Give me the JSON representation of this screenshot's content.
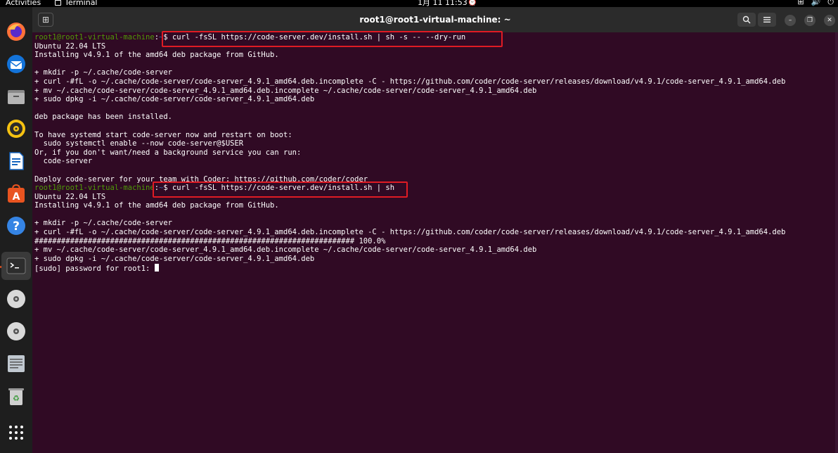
{
  "topbar": {
    "activities": "Activities",
    "app_name": "Terminal",
    "clock": "1月 11  11:53"
  },
  "window": {
    "title": "root1@root1-virtual-machine: ~"
  },
  "dock": {
    "items": [
      {
        "name": "firefox-icon"
      },
      {
        "name": "thunderbird-icon"
      },
      {
        "name": "files-icon"
      },
      {
        "name": "rhythmbox-icon"
      },
      {
        "name": "libreoffice-writer-icon"
      },
      {
        "name": "app-center-icon"
      },
      {
        "name": "help-icon"
      },
      {
        "name": "terminal-icon"
      },
      {
        "name": "disc-icon"
      },
      {
        "name": "disc-icon-2"
      },
      {
        "name": "text-editor-icon"
      },
      {
        "name": "trash-icon"
      },
      {
        "name": "show-apps-icon"
      }
    ]
  },
  "terminal": {
    "prompt_user": "root1@root1-virtual-machine",
    "prompt_sep": ":",
    "prompt_path": "~",
    "cmd1": "$ curl -fsSL https://code-server.dev/install.sh | sh -s -- --dry-run",
    "out1": [
      "Ubuntu 22.04 LTS",
      "Installing v4.9.1 of the amd64 deb package from GitHub.",
      "",
      "+ mkdir -p ~/.cache/code-server",
      "+ curl -#fL -o ~/.cache/code-server/code-server_4.9.1_amd64.deb.incomplete -C - https://github.com/coder/code-server/releases/download/v4.9.1/code-server_4.9.1_amd64.deb",
      "+ mv ~/.cache/code-server/code-server_4.9.1_amd64.deb.incomplete ~/.cache/code-server/code-server_4.9.1_amd64.deb",
      "+ sudo dpkg -i ~/.cache/code-server/code-server_4.9.1_amd64.deb",
      "",
      "deb package has been installed.",
      "",
      "To have systemd start code-server now and restart on boot:",
      "  sudo systemctl enable --now code-server@$USER",
      "Or, if you don't want/need a background service you can run:",
      "  code-server",
      "",
      "Deploy code-server for your team with Coder: https://github.com/coder/coder"
    ],
    "cmd2": "$ curl -fsSL https://code-server.dev/install.sh | sh",
    "out2": [
      "Ubuntu 22.04 LTS",
      "Installing v4.9.1 of the amd64 deb package from GitHub.",
      "",
      "+ mkdir -p ~/.cache/code-server",
      "+ curl -#fL -o ~/.cache/code-server/code-server_4.9.1_amd64.deb.incomplete -C - https://github.com/coder/code-server/releases/download/v4.9.1/code-server_4.9.1_amd64.deb",
      "######################################################################## 100.0%",
      "+ mv ~/.cache/code-server/code-server_4.9.1_amd64.deb.incomplete ~/.cache/code-server/code-server_4.9.1_amd64.deb",
      "+ sudo dpkg -i ~/.cache/code-server/code-server_4.9.1_amd64.deb"
    ],
    "sudo_prompt": "[sudo] password for root1: "
  },
  "colors": {
    "terminal_bg": "#300a24",
    "prompt_user": "#4e9a06",
    "highlight_box": "#e01b24"
  }
}
